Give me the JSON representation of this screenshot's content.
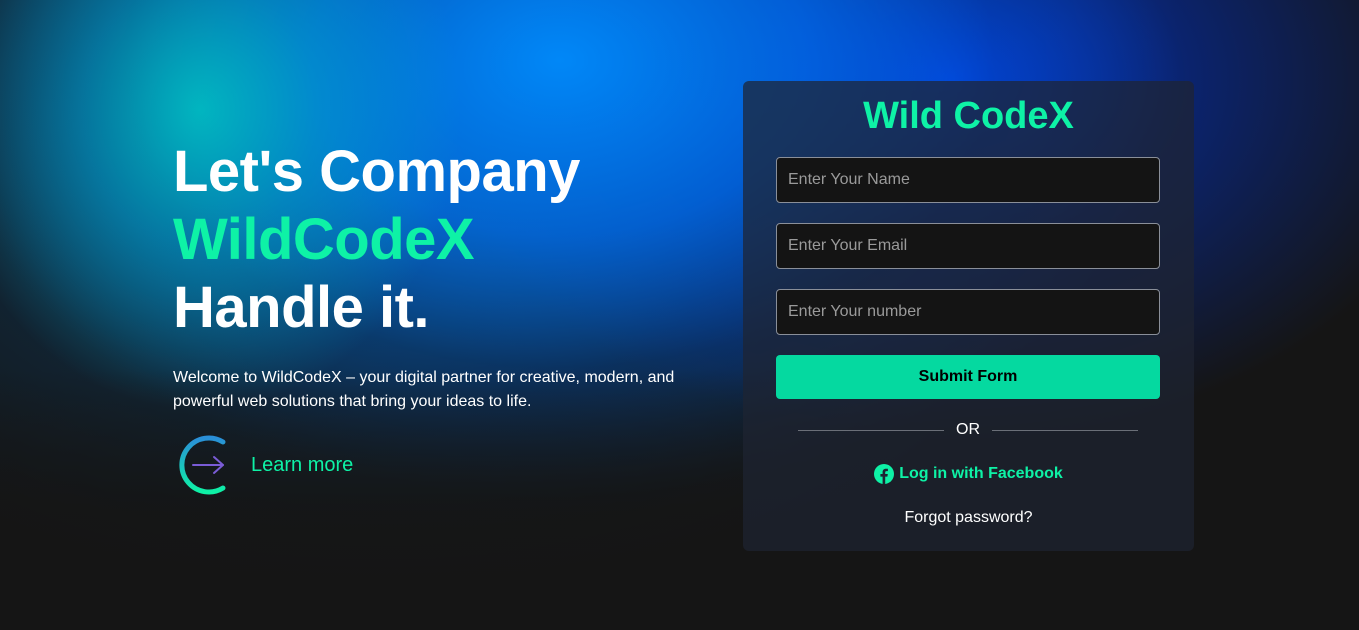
{
  "hero": {
    "title_line1": "Let's Company",
    "title_accent": "WildCodeX",
    "title_line3": "Handle it.",
    "description": "Welcome to WildCodeX – your digital partner for creative, modern, and powerful web solutions that bring your ideas to life.",
    "cta_label": "Learn more",
    "cta_icon": "arrow-right-icon"
  },
  "form": {
    "brand": "Wild CodeX",
    "name_placeholder": "Enter Your Name",
    "email_placeholder": "Enter Your Email",
    "number_placeholder": "Enter Your number",
    "name_value": "",
    "email_value": "",
    "number_value": "",
    "submit_label": "Submit Form",
    "divider_text": "OR",
    "facebook_label": "Log in with Facebook",
    "facebook_icon": "facebook-icon",
    "forgot_label": "Forgot password?"
  },
  "colors": {
    "accent": "#0ef2a6",
    "button": "#05d9a0",
    "background": "#151515",
    "glow_blue": "#0066ff"
  }
}
